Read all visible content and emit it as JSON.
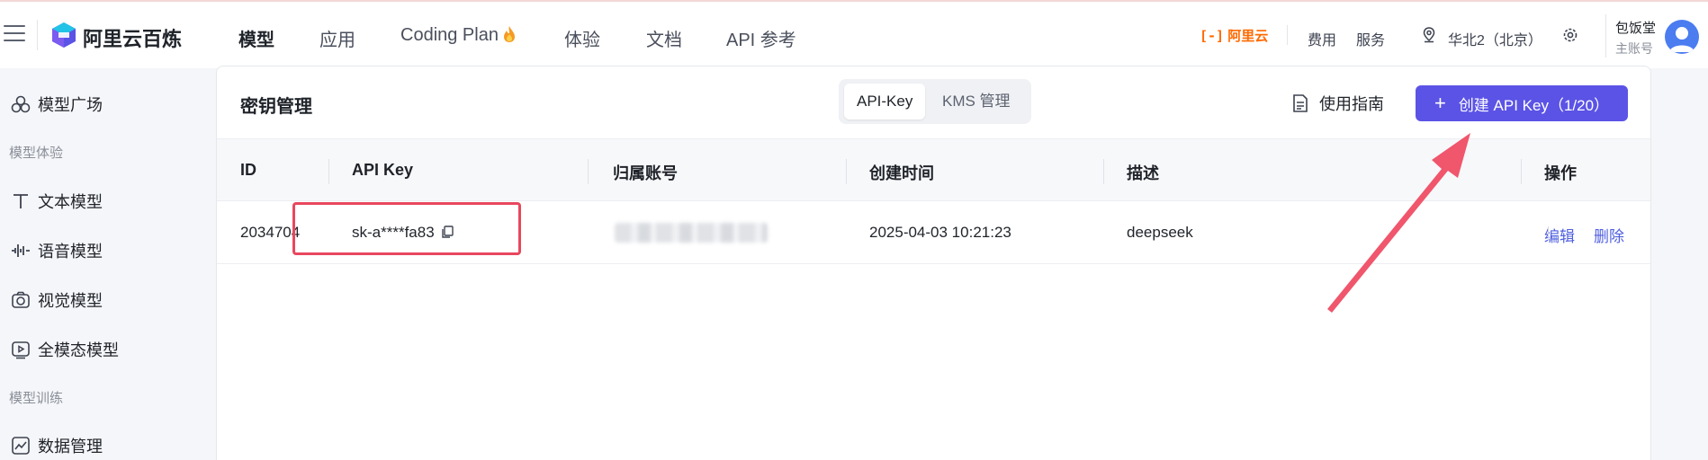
{
  "brand": {
    "name": "阿里云百炼"
  },
  "nav": {
    "items": [
      "模型",
      "应用",
      "Coding Plan",
      "体验",
      "文档",
      "API 参考"
    ],
    "active": "模型"
  },
  "topbar": {
    "aliyun_logo": "阿里云",
    "links": [
      "费用",
      "服务"
    ],
    "region": "华北2（北京）",
    "user_name": "包饭堂",
    "user_role": "主账号"
  },
  "sidebar": {
    "items": [
      {
        "label": "模型广场",
        "icon": "model-plaza-icon"
      },
      {
        "group": "模型体验"
      },
      {
        "label": "文本模型",
        "icon": "text-icon"
      },
      {
        "label": "语音模型",
        "icon": "audio-wave-icon"
      },
      {
        "label": "视觉模型",
        "icon": "camera-icon"
      },
      {
        "label": "全模态模型",
        "icon": "video-icon"
      },
      {
        "group": "模型训练"
      },
      {
        "label": "数据管理",
        "icon": "chart-icon"
      }
    ]
  },
  "panel": {
    "title": "密钥管理",
    "tabs": [
      "API-Key",
      "KMS 管理"
    ],
    "active_tab": "API-Key",
    "guide_label": "使用指南",
    "create_button": "创建 API Key（1/20）"
  },
  "table": {
    "headers": [
      "ID",
      "API Key",
      "归属账号",
      "创建时间",
      "描述",
      "操作"
    ],
    "rows": [
      {
        "id": "2034704",
        "api_key": "sk-a****fa83",
        "account": "",
        "created": "2025-04-03 10:21:23",
        "description": "deepseek",
        "actions": [
          "编辑",
          "删除"
        ]
      }
    ]
  },
  "colors": {
    "primary": "#5b53e6",
    "link": "#4f5fe0",
    "highlight": "#e8475e",
    "aliyun": "#ff6a00"
  }
}
